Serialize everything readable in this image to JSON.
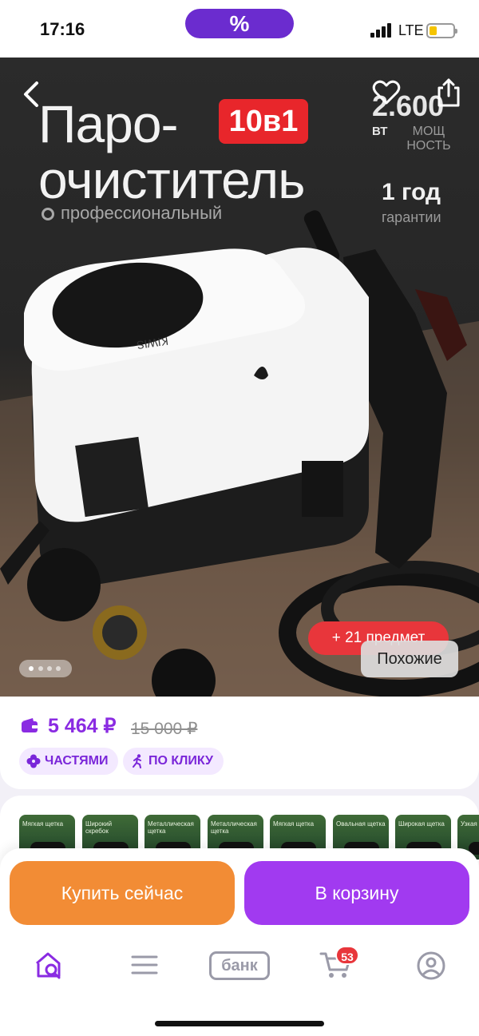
{
  "status_bar": {
    "time": "17:16",
    "promo_symbol": "%",
    "network": "LTE"
  },
  "hero": {
    "title_line1": "Паро-",
    "title_line2": "очиститель",
    "badge": "10в1",
    "subtitle": "профессиональный",
    "power_value": "2.600",
    "power_unit": "ВТ",
    "power_label": "МОЩ НОСТЬ",
    "warranty_value": "1 год",
    "warranty_label": "гарантии",
    "device_brand": "KIWIS",
    "more_items": "+ 21 предмет",
    "similar_label": "Похожие",
    "gallery": {
      "total_pages": 4,
      "active_page": 1
    }
  },
  "price": {
    "current": "5 464 ₽",
    "old": "15 000 ₽"
  },
  "chips": {
    "installments": "ЧАСТЯМИ",
    "one_click": "ПО КЛИКУ"
  },
  "variants": [
    {
      "label": "Мягкая щетка"
    },
    {
      "label": "Широкий скребок"
    },
    {
      "label": "Металлическая щетка"
    },
    {
      "label": "Металлическая щетка"
    },
    {
      "label": "Мягкая щетка"
    },
    {
      "label": "Овальная щетка"
    },
    {
      "label": "Широкая щетка"
    },
    {
      "label": "Узкая щ"
    }
  ],
  "actions": {
    "buy_now": "Купить сейчас",
    "add_to_cart": "В корзину"
  },
  "tab_bar": {
    "bank_label": "банк",
    "cart_count": "53",
    "icons": [
      "home-search-icon",
      "catalog-icon",
      "bank-icon",
      "cart-icon",
      "profile-icon"
    ],
    "active_color": "#8a2be2",
    "inactive_color": "#9a9aa8"
  },
  "colors": {
    "accent_purple": "#a13af0",
    "buy_orange": "#f28c35",
    "badge_red": "#e8262b"
  }
}
